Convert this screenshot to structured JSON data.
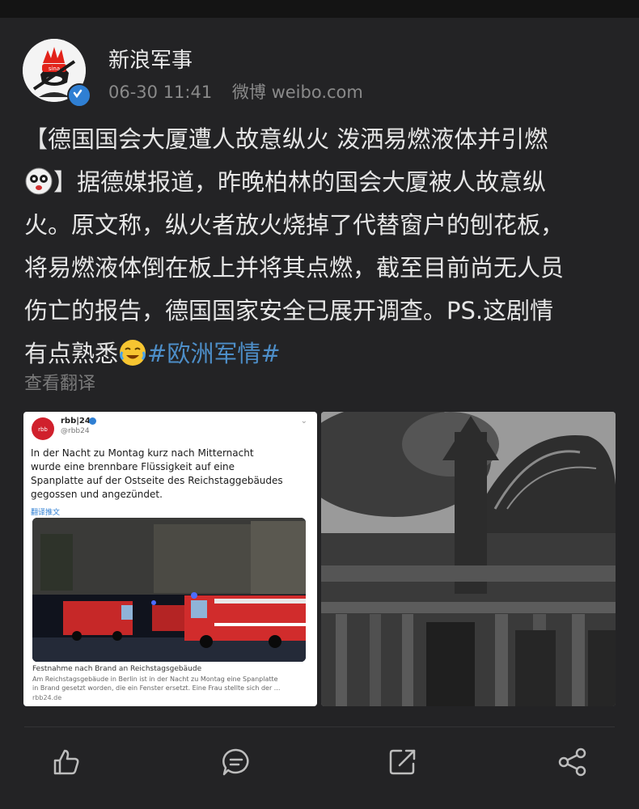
{
  "account": {
    "name": "新浪军事",
    "timestamp": "06-30 11:41",
    "source": "微博 weibo.com"
  },
  "post": {
    "lines": [
      "【德国国会大厦遭人故意纵火 泼洒易燃液体并引燃",
      "】据德媒报道，昨晚柏林的国会大厦被人故意纵",
      "火。原文称，纵火者放火烧掉了代替窗户的刨花板，",
      "将易燃液体倒在板上并将其点燃，截至目前尚无人员",
      "伤亡的报告，德国国家安全已展开调查。PS.这剧情",
      "有点熟悉"
    ],
    "hashtag": "#欧洲军情#",
    "emojis": [
      "shock-face-emoji",
      "crying-laugh-emoji"
    ]
  },
  "translate_label": "查看翻译",
  "tweet": {
    "name": "rbb|24",
    "handle": "@rbb24",
    "text_lines": [
      "In der Nacht zu Montag kurz nach Mitternacht",
      "wurde eine brennbare Flüssigkeit auf eine",
      "Spanplatte auf der Ostseite des Reichstaggebäudes",
      "gegossen und angezündet."
    ],
    "translate": "翻译推文",
    "caption_title": "Festnahme nach Brand an Reichstagsgebäude",
    "caption_lines": [
      "Am Reichstagsgebäude in Berlin ist in der Nacht zu Montag eine Spanplatte",
      "in Brand gesetzt worden, die ein Fenster ersetzt. Eine Frau stellte sich der ..."
    ],
    "link": "rbb24.de"
  },
  "actions": [
    "like-icon",
    "comment-icon",
    "repost-icon",
    "share-icon"
  ],
  "colors": {
    "background": "#232325",
    "text": "#e6e6e6",
    "meta": "#8a8a8a",
    "hashtag": "#4d8ec8",
    "verified": "#2f7fd3"
  }
}
